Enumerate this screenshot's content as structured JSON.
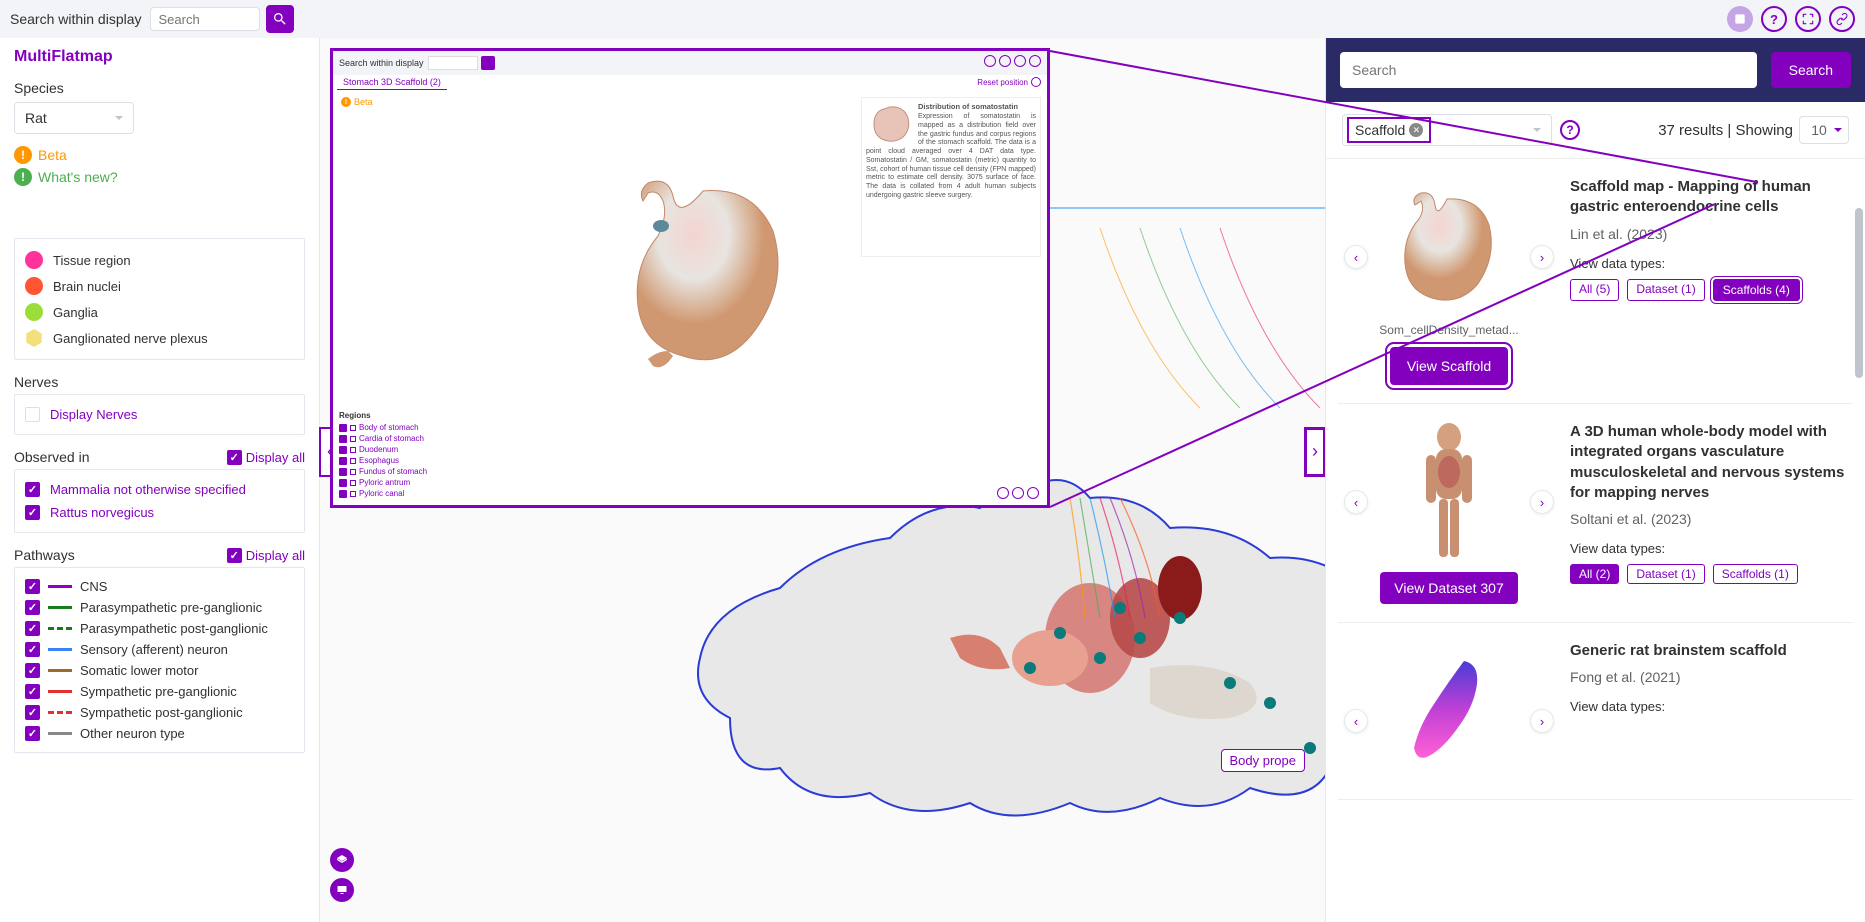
{
  "topbar": {
    "search_label": "Search within display",
    "search_placeholder": "Search"
  },
  "sidebar": {
    "title": "MultiFlatmap",
    "species_label": "Species",
    "species_value": "Rat",
    "beta_label": "Beta",
    "whatsnew_label": "What's new?",
    "legend": [
      {
        "label": "Tissue region",
        "color": "#ff3399"
      },
      {
        "label": "Brain nuclei",
        "color": "#ff5533"
      },
      {
        "label": "Ganglia",
        "color": "#9cdd3a"
      },
      {
        "label": "Ganglionated nerve plexus",
        "color": "#f2e07a"
      }
    ],
    "nerves_header": "Nerves",
    "display_nerves": "Display Nerves",
    "observed_header": "Observed in",
    "display_all": "Display all",
    "observed": [
      "Mammalia not otherwise specified",
      "Rattus norvegicus"
    ],
    "pathways_header": "Pathways",
    "pathways": [
      {
        "label": "CNS",
        "color": "#9100c1",
        "dashed": false
      },
      {
        "label": "Parasympathetic pre-ganglionic",
        "color": "#1a7a1a",
        "dashed": false
      },
      {
        "label": "Parasympathetic post-ganglionic",
        "color": "#1a7a1a",
        "dashed": true
      },
      {
        "label": "Sensory (afferent) neuron",
        "color": "#3b82f6",
        "dashed": false
      },
      {
        "label": "Somatic lower motor",
        "color": "#9c6a2e",
        "dashed": false
      },
      {
        "label": "Sympathetic pre-ganglionic",
        "color": "#e03030",
        "dashed": false
      },
      {
        "label": "Sympathetic post-ganglionic",
        "color": "#e03030",
        "dashed": true
      },
      {
        "label": "Other neuron type",
        "color": "#888888",
        "dashed": false
      }
    ]
  },
  "overlay": {
    "search_label": "Search within display",
    "tab": "Stomach 3D Scaffold (2)",
    "beta": "Beta",
    "info_title": "Distribution of somatostatin",
    "info_body": "Expression of somatostatin is mapped as a distribution field over the gastric fundus and corpus regions of the stomach scaffold. The data is a point cloud averaged over 4 DAT data type. Somatostatin / GM, somatostatin (metric) quantity to Sst, cohort of human tissue cell density (FPN mapped) metric to estimate cell density. 3075 surface of face. The data is collated from 4 adult human subjects undergoing gastric sleeve surgery.",
    "regions_header": "Regions",
    "reset_label": "Reset position",
    "regions": [
      "Body of stomach",
      "Cardia of stomach",
      "Duodenum",
      "Esophagus",
      "Fundus of stomach",
      "Pyloric antrum",
      "Pyloric canal"
    ]
  },
  "canvas": {
    "body_proper_label": "Body prope"
  },
  "side": {
    "search_placeholder": "Search",
    "search_btn": "Search",
    "filter_tag": "Scaffold",
    "results_count": "37 results | Showing",
    "page_size": "10",
    "cards": [
      {
        "title": "Scaffold map - Mapping of human gastric enteroendocrine cells",
        "authors": "Lin et al. (2023)",
        "view_types_label": "View data types:",
        "caption": "Som_cellDensity_metad...",
        "tags": [
          {
            "label": "All (5)",
            "filled": false
          },
          {
            "label": "Dataset (1)",
            "filled": false
          },
          {
            "label": "Scaffolds (4)",
            "filled": true,
            "highlighted": true
          }
        ],
        "view_btn": "View Scaffold",
        "view_highlighted": true
      },
      {
        "title": "A 3D human whole-body model with integrated organs vasculature musculoskeletal and nervous systems for mapping nerves",
        "authors": "Soltani et al. (2023)",
        "view_types_label": "View data types:",
        "caption": "",
        "tags": [
          {
            "label": "All (2)",
            "filled": true
          },
          {
            "label": "Dataset (1)",
            "filled": false
          },
          {
            "label": "Scaffolds (1)",
            "filled": false
          }
        ],
        "view_btn": "View Dataset 307",
        "view_highlighted": false
      },
      {
        "title": "Generic rat brainstem scaffold",
        "authors": "Fong et al. (2021)",
        "view_types_label": "View data types:",
        "caption": "",
        "tags": [],
        "view_btn": "",
        "view_highlighted": false
      }
    ]
  }
}
